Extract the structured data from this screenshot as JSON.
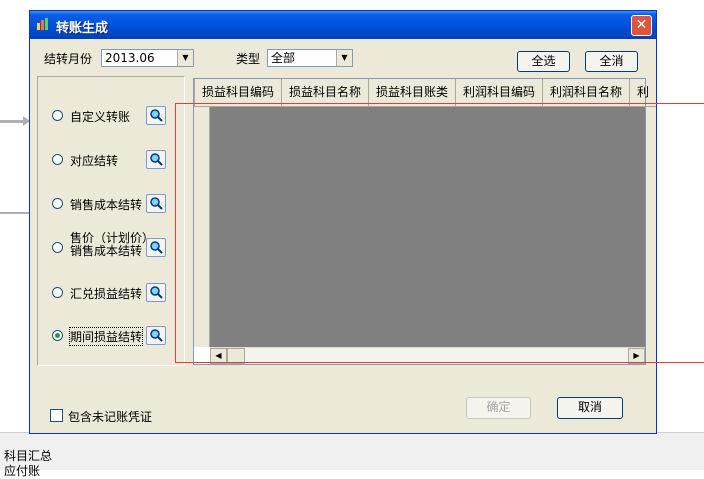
{
  "background": {
    "bottom_text_1": "科目汇总",
    "bottom_text_2": "应付账"
  },
  "window": {
    "title": "转账生成",
    "close_glyph": "✕",
    "month_label": "结转月份",
    "month_value": "2013.06",
    "type_label": "类型",
    "type_value": "全部",
    "select_all": "全选",
    "clear_all": "全消",
    "options": [
      {
        "label": "自定义转账",
        "checked": false
      },
      {
        "label": "对应结转",
        "checked": false
      },
      {
        "label": "销售成本结转",
        "checked": false
      },
      {
        "label": "售价（计划价）\n销售成本结转",
        "line1": "售价（计划价）",
        "line2": "销售成本结转",
        "checked": false
      },
      {
        "label": "汇兑损益结转",
        "checked": false
      },
      {
        "label": "期间损益结转",
        "checked": true
      }
    ],
    "columns": [
      "损益科目编码",
      "损益科目名称",
      "损益科目账类",
      "利润科目编码",
      "利润科目名称",
      "利"
    ],
    "include_unposted": "包含未记账凭证",
    "ok": "确定",
    "cancel": "取消"
  },
  "colors": {
    "title_bar": "#0054e3",
    "grid_body": "#808080",
    "highlight_rect": "#e43c3c"
  }
}
